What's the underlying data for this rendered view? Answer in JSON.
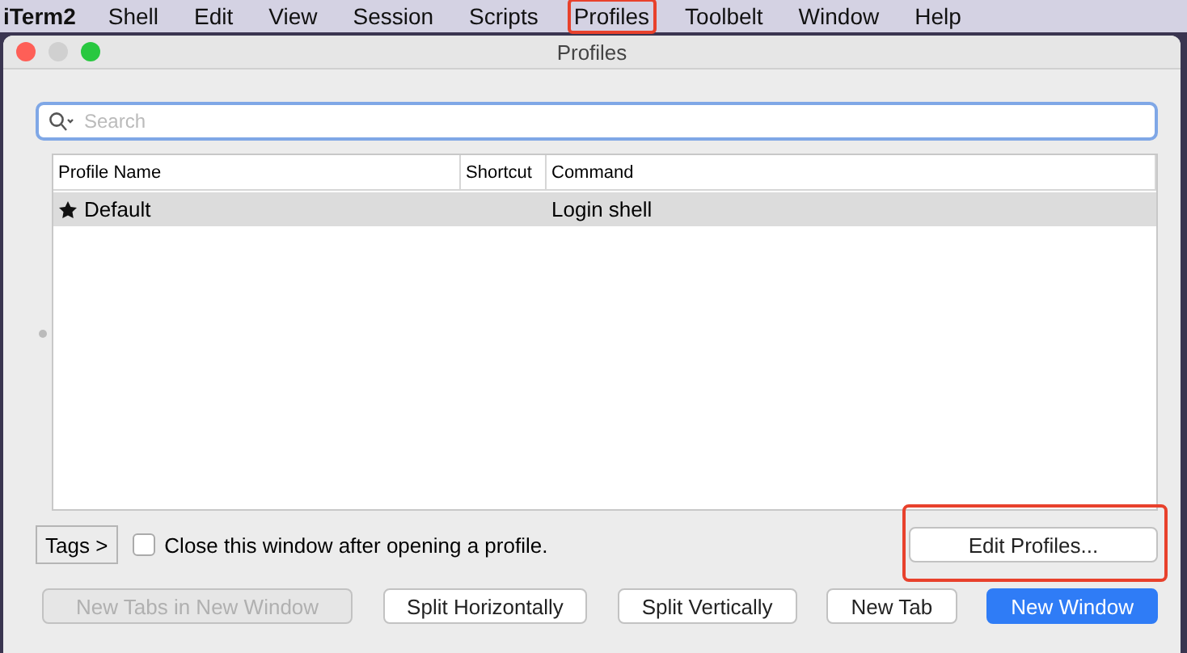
{
  "menu_bar": {
    "app_name": "iTerm2",
    "items": [
      {
        "label": "Shell",
        "highlighted": false
      },
      {
        "label": "Edit",
        "highlighted": false
      },
      {
        "label": "View",
        "highlighted": false
      },
      {
        "label": "Session",
        "highlighted": false
      },
      {
        "label": "Scripts",
        "highlighted": false
      },
      {
        "label": "Profiles",
        "highlighted": true
      },
      {
        "label": "Toolbelt",
        "highlighted": false
      },
      {
        "label": "Window",
        "highlighted": false
      },
      {
        "label": "Help",
        "highlighted": false
      }
    ]
  },
  "window": {
    "title": "Profiles"
  },
  "search": {
    "placeholder": "Search"
  },
  "table": {
    "columns": [
      "Profile Name",
      "Shortcut",
      "Command"
    ],
    "rows": [
      {
        "name": "Default",
        "starred": true,
        "command": "Login shell",
        "selected": true
      }
    ]
  },
  "tags_button": "Tags >",
  "close_option": {
    "label": "Close this window after opening a profile.",
    "checked": false
  },
  "edit_profiles": {
    "label": "Edit Profiles...",
    "highlighted": true
  },
  "buttons": [
    {
      "label": "New Tabs in New Window",
      "disabled": true,
      "primary": false
    },
    {
      "label": "Split Horizontally",
      "disabled": false,
      "primary": false
    },
    {
      "label": "Split Vertically",
      "disabled": false,
      "primary": false
    },
    {
      "label": "New Tab",
      "disabled": false,
      "primary": false
    },
    {
      "label": "New Window",
      "disabled": false,
      "primary": true
    }
  ]
}
